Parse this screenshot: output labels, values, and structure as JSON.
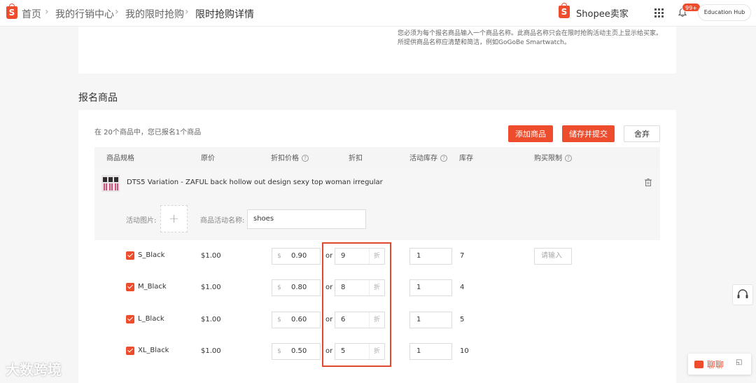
{
  "breadcrumb": {
    "home": "首页",
    "marketing": "我的行销中心",
    "flash_sale": "我的限时抢购",
    "current": "限时抢购详情"
  },
  "header": {
    "brand_logo_letter": "S",
    "brand": "Shopee卖家",
    "notification_count": "99+",
    "education_hub": "Education Hub"
  },
  "notice": "您必须为每个报名商品输入一个商品名称。此商品名称只会在限时抢购活动主页上显示给买家。所提供商品名称应清楚和简洁，例如GoGoBe Smartwatch。",
  "section": {
    "title": "报名商品",
    "count_text": "在 20个商品中，您已报名1个商品",
    "add_button": "添加商品",
    "save_submit_button": "储存并提交",
    "discard_button": "舍弃"
  },
  "table": {
    "headers": {
      "spec": "商品规格",
      "original_price": "原价",
      "discount_price": "折扣价格",
      "discount": "折扣",
      "campaign_stock": "活动库存",
      "stock": "库存",
      "purchase_limit": "购买限制"
    },
    "help_mark": "?"
  },
  "product": {
    "name": "DTS5 Variation - ZAFUL back hollow out design sexy top woman irregular",
    "image_label": "活动图片:",
    "upload_symbol": "+",
    "campaign_name_label": "商品活动名称:",
    "campaign_name_value": "shoes"
  },
  "currency_prefix": "$",
  "discount_suffix": "折",
  "or_text": "or",
  "limit_placeholder": "请输入",
  "variations": [
    {
      "name": "S_Black",
      "price": "$1.00",
      "discount_price": "0.90",
      "discount": "9",
      "campaign_stock": "1",
      "stock": "7"
    },
    {
      "name": "M_Black",
      "price": "$1.00",
      "discount_price": "0.80",
      "discount": "8",
      "campaign_stock": "1",
      "stock": "4"
    },
    {
      "name": "L_Black",
      "price": "$1.00",
      "discount_price": "0.60",
      "discount": "6",
      "campaign_stock": "1",
      "stock": "5"
    },
    {
      "name": "XL_Black",
      "price": "$1.00",
      "discount_price": "0.50",
      "discount": "5",
      "campaign_stock": "1",
      "stock": "10"
    }
  ],
  "chat": {
    "label": "聊聊"
  },
  "watermark": "大数跨境",
  "colors": {
    "accent": "#ee4d2d",
    "highlight_border": "#e2482e"
  }
}
